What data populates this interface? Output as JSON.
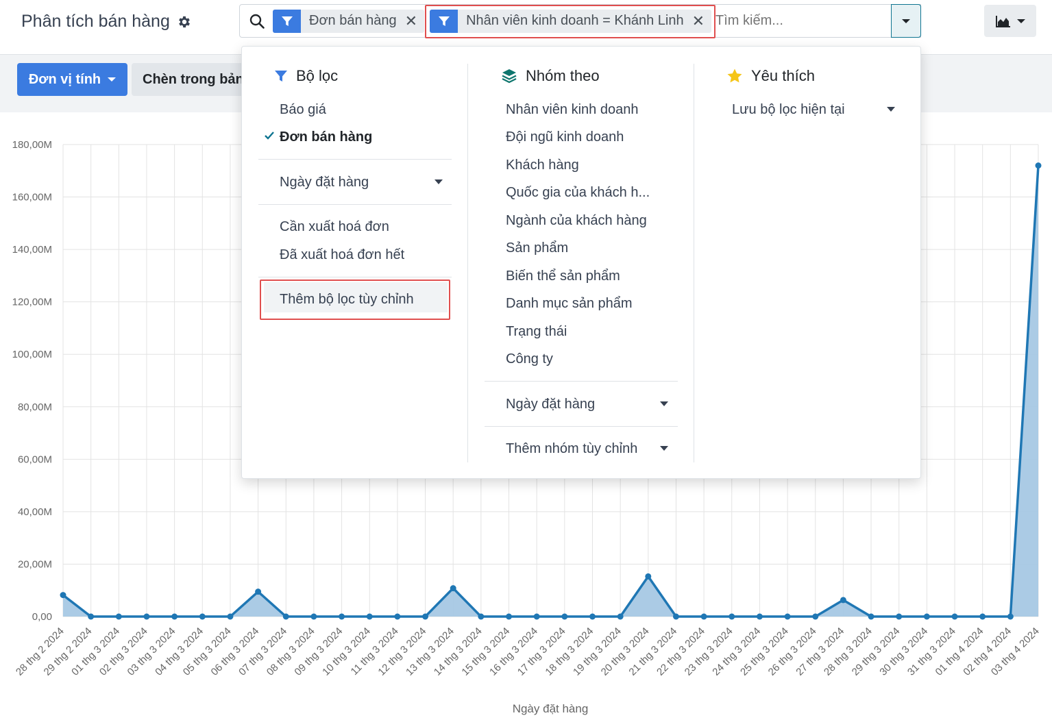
{
  "header": {
    "title": "Phân tích bán hàng",
    "search": {
      "facets": [
        {
          "label": "Đơn bán hàng"
        },
        {
          "label": "Nhân viên kinh doanh = Khánh Linh"
        }
      ],
      "placeholder": "Tìm kiếm..."
    }
  },
  "toolbar": {
    "measure_label": "Đơn vị tính",
    "insert_label": "Chèn trong bảng"
  },
  "dropdown": {
    "filters": {
      "heading": "Bộ lọc",
      "items": [
        "Báo giá",
        "Đơn bán hàng"
      ],
      "active_index": 1,
      "date_filter": "Ngày đặt hàng",
      "invoice_items": [
        "Cần xuất hoá đơn",
        "Đã xuất hoá đơn hết"
      ],
      "add_custom": "Thêm bộ lọc tùy chỉnh"
    },
    "groupby": {
      "heading": "Nhóm theo",
      "items": [
        "Nhân viên kinh doanh",
        "Đội ngũ kinh doanh",
        "Khách hàng",
        "Quốc gia của khách h...",
        "Ngành của khách hàng",
        "Sản phẩm",
        "Biến thể sản phẩm",
        "Danh mục sản phẩm",
        "Trạng thái",
        "Công ty"
      ],
      "date_group": "Ngày đặt hàng",
      "add_custom": "Thêm nhóm tùy chỉnh"
    },
    "favorites": {
      "heading": "Yêu thích",
      "save_current": "Lưu bộ lọc hiện tại"
    }
  },
  "colors": {
    "accent": "#3b7be0",
    "line": "#1f77b4",
    "area": "#a6c8e4",
    "highlight": "#e04e4e",
    "teal": "#0e7490",
    "star": "#f5c518"
  },
  "chart_data": {
    "type": "area",
    "xlabel": "Ngày đặt hàng",
    "ylim": [
      0,
      180
    ],
    "yticks": [
      "0,00",
      "20,00M",
      "40,00M",
      "60,00M",
      "80,00M",
      "100,00M",
      "120,00M",
      "140,00M",
      "160,00M",
      "180,00M"
    ],
    "categories": [
      "28 thg 2 2024",
      "29 thg 2 2024",
      "01 thg 3 2024",
      "02 thg 3 2024",
      "03 thg 3 2024",
      "04 thg 3 2024",
      "05 thg 3 2024",
      "06 thg 3 2024",
      "07 thg 3 2024",
      "08 thg 3 2024",
      "09 thg 3 2024",
      "10 thg 3 2024",
      "11 thg 3 2024",
      "12 thg 3 2024",
      "13 thg 3 2024",
      "14 thg 3 2024",
      "15 thg 3 2024",
      "16 thg 3 2024",
      "17 thg 3 2024",
      "18 thg 3 2024",
      "19 thg 3 2024",
      "20 thg 3 2024",
      "21 thg 3 2024",
      "22 thg 3 2024",
      "23 thg 3 2024",
      "24 thg 3 2024",
      "25 thg 3 2024",
      "26 thg 3 2024",
      "27 thg 3 2024",
      "28 thg 3 2024",
      "29 thg 3 2024",
      "30 thg 3 2024",
      "31 thg 3 2024",
      "01 thg 4 2024",
      "02 thg 4 2024",
      "03 thg 4 2024"
    ],
    "values": [
      8.2,
      0,
      0,
      0,
      0,
      0,
      0,
      9.5,
      0,
      0,
      0,
      0,
      0,
      0,
      10.8,
      0,
      0,
      0,
      0,
      0,
      0,
      15.3,
      0,
      0,
      0,
      0,
      0,
      0,
      6.3,
      0,
      0,
      0,
      0,
      0,
      0,
      172
    ]
  }
}
